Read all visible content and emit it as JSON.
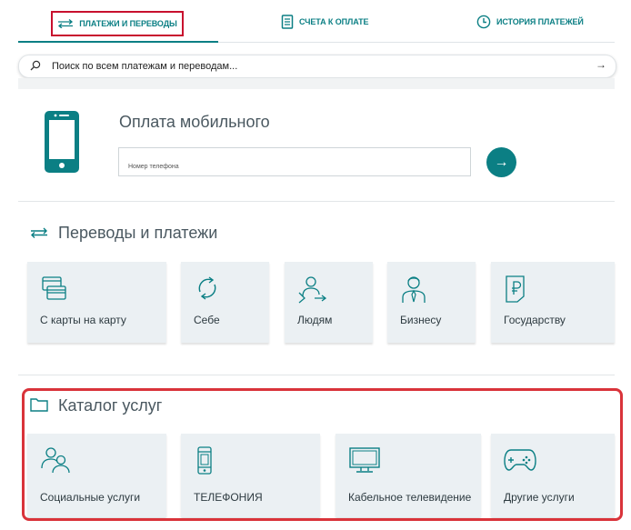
{
  "tabs": [
    {
      "label": "ПЛАТЕЖИ И ПЕРЕВОДЫ",
      "icon": "arrows-exchange-icon"
    },
    {
      "label": "СЧЕТА К ОПЛАТЕ",
      "icon": "document-icon"
    },
    {
      "label": "ИСТОРИЯ ПЛАТЕЖЕЙ",
      "icon": "clock-icon"
    }
  ],
  "search": {
    "placeholder": "Поиск по всем платежам и переводам..."
  },
  "mobile": {
    "title": "Оплата мобильного",
    "phone_placeholder": "Номер телефона"
  },
  "transfers": {
    "title": "Переводы и платежи",
    "cards": [
      {
        "label": "С карты на карту",
        "icon": "cards-icon"
      },
      {
        "label": "Себе",
        "icon": "refresh-icon"
      },
      {
        "label": "Людям",
        "icon": "person-exchange-icon"
      },
      {
        "label": "Бизнесу",
        "icon": "businessman-icon"
      },
      {
        "label": "Государству",
        "icon": "ruble-document-icon"
      }
    ]
  },
  "catalog": {
    "title": "Каталог услуг",
    "cards": [
      {
        "label": "Социальные услуги",
        "icon": "people-icon"
      },
      {
        "label": "ТЕЛЕФОНИЯ",
        "icon": "mobile-phone-icon"
      },
      {
        "label": "Кабельное телевидение",
        "icon": "tv-icon"
      },
      {
        "label": "Другие услуги",
        "icon": "gamepad-icon"
      }
    ]
  },
  "colors": {
    "accent": "#0b7f84",
    "highlight_frame": "#d9333a",
    "card_bg": "#ebf0f3"
  }
}
